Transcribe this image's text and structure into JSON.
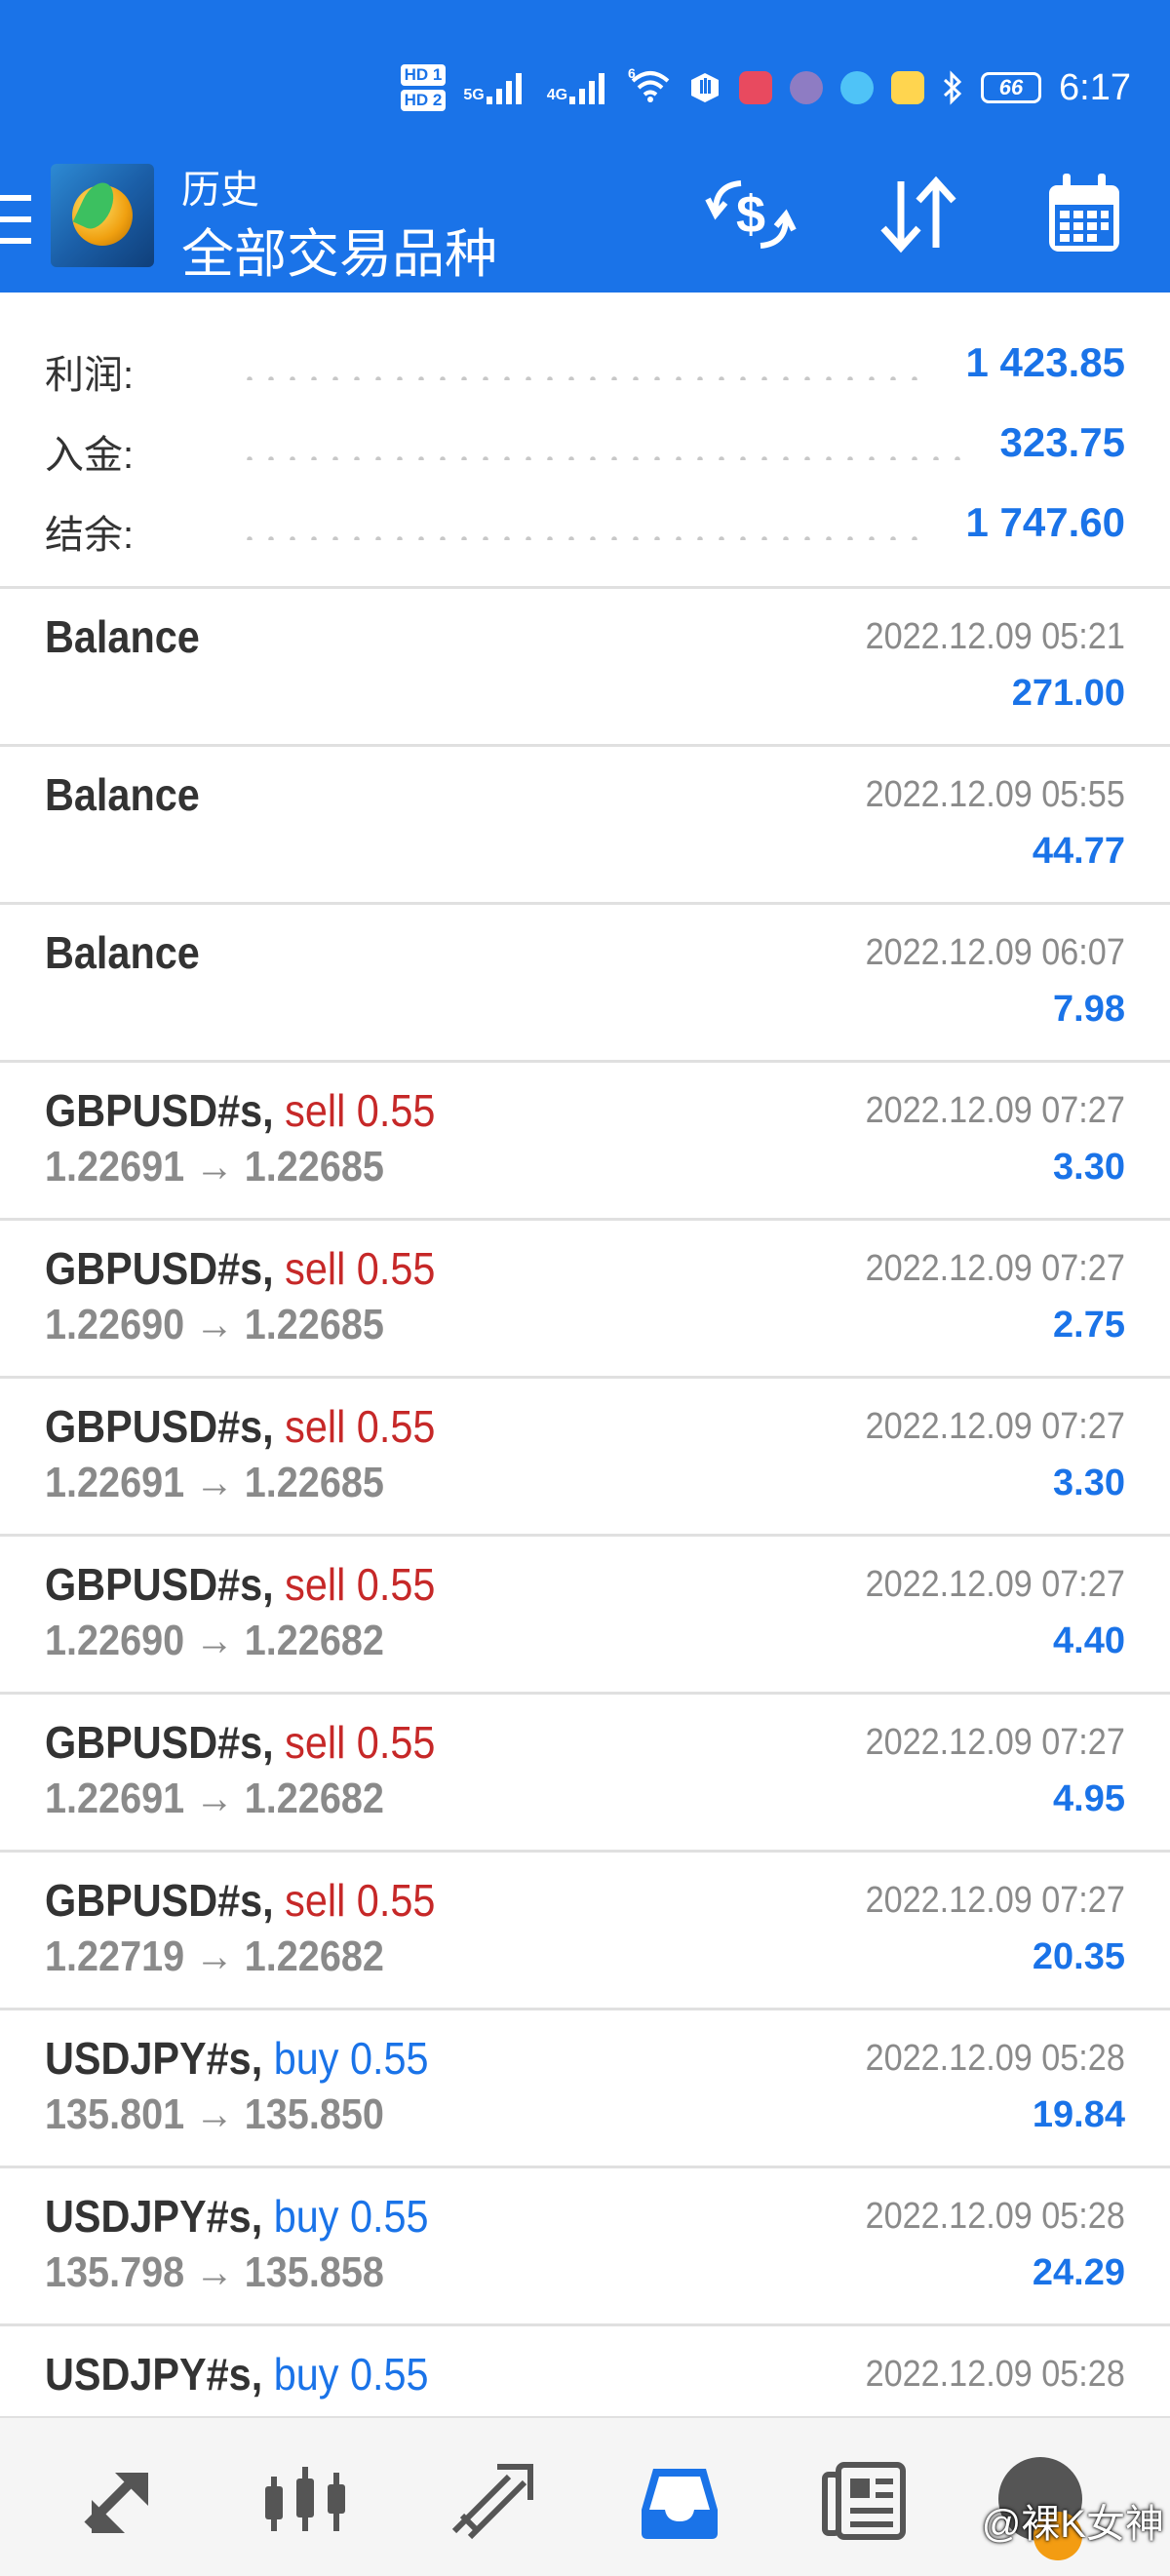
{
  "status_bar": {
    "hd1": "HD 1",
    "hd2": "HD 2",
    "net1": "5G",
    "net2": "4G",
    "wifi_gen": "6",
    "battery": "66",
    "time": "6:17"
  },
  "header": {
    "title_small": "历史",
    "title_big": "全部交易品种",
    "icons": [
      "menu-icon",
      "app-logo",
      "currency-exchange-icon",
      "sort-icon",
      "calendar-icon"
    ]
  },
  "summary": [
    {
      "label": "利润:",
      "value": "1 423.85"
    },
    {
      "label": "入金:",
      "value": "323.75"
    },
    {
      "label": "结余:",
      "value": "1 747.60"
    }
  ],
  "deals": [
    {
      "symbol": "Balance",
      "side": "",
      "volume": "",
      "prices": "",
      "time": "2022.12.09 05:21",
      "profit": "271.00"
    },
    {
      "symbol": "Balance",
      "side": "",
      "volume": "",
      "prices": "",
      "time": "2022.12.09 05:55",
      "profit": "44.77"
    },
    {
      "symbol": "Balance",
      "side": "",
      "volume": "",
      "prices": "",
      "time": "2022.12.09 06:07",
      "profit": "7.98"
    },
    {
      "symbol": "GBPUSD#s,",
      "side": "sell 0.55",
      "prices": "1.22691 → 1.22685",
      "time": "2022.12.09 07:27",
      "profit": "3.30"
    },
    {
      "symbol": "GBPUSD#s,",
      "side": "sell 0.55",
      "prices": "1.22690 → 1.22685",
      "time": "2022.12.09 07:27",
      "profit": "2.75"
    },
    {
      "symbol": "GBPUSD#s,",
      "side": "sell 0.55",
      "prices": "1.22691 → 1.22685",
      "time": "2022.12.09 07:27",
      "profit": "3.30"
    },
    {
      "symbol": "GBPUSD#s,",
      "side": "sell 0.55",
      "prices": "1.22690 → 1.22682",
      "time": "2022.12.09 07:27",
      "profit": "4.40"
    },
    {
      "symbol": "GBPUSD#s,",
      "side": "sell 0.55",
      "prices": "1.22691 → 1.22682",
      "time": "2022.12.09 07:27",
      "profit": "4.95"
    },
    {
      "symbol": "GBPUSD#s,",
      "side": "sell 0.55",
      "prices": "1.22719 → 1.22682",
      "time": "2022.12.09 07:27",
      "profit": "20.35"
    },
    {
      "symbol": "USDJPY#s,",
      "side": "buy 0.55",
      "prices": "135.801 → 135.850",
      "time": "2022.12.09 05:28",
      "profit": "19.84"
    },
    {
      "symbol": "USDJPY#s,",
      "side": "buy 0.55",
      "prices": "135.798 → 135.858",
      "time": "2022.12.09 05:28",
      "profit": "24.29"
    },
    {
      "symbol": "USDJPY#s,",
      "side": "buy 0.55",
      "prices": "",
      "time": "2022.12.09 05:28",
      "profit": ""
    }
  ],
  "bottom_nav": {
    "items": [
      "quotes-icon",
      "chart-icon",
      "trade-icon",
      "history-icon",
      "news-icon"
    ],
    "active": "history-icon",
    "watermark": "@裸K女神"
  },
  "colors": {
    "primary": "#1a73e8",
    "sell": "#c62828",
    "text": "#333333",
    "muted": "#8a8a8a"
  }
}
